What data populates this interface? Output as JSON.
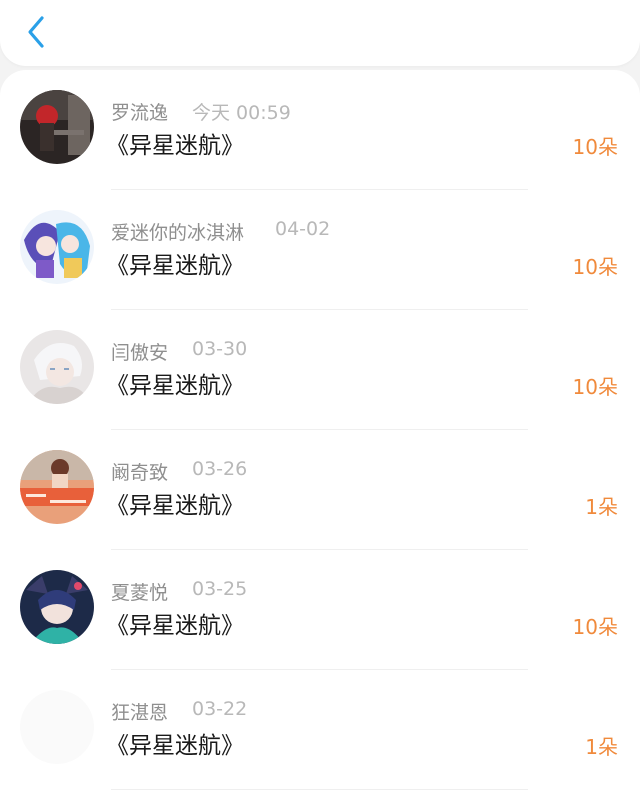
{
  "nav": {
    "back_icon": "chevron-left-icon",
    "accent": "#2aa0e8"
  },
  "list": {
    "count_color": "#f08a3c",
    "items": [
      {
        "name": "罗流逸",
        "date": "今天 00:59",
        "book": "《异星迷航》",
        "count": "10朵"
      },
      {
        "name": "爱迷你的冰淇淋",
        "date": "04-02",
        "book": "《异星迷航》",
        "count": "10朵"
      },
      {
        "name": "闫傲安",
        "date": "03-30",
        "book": "《异星迷航》",
        "count": "10朵"
      },
      {
        "name": "阚奇致",
        "date": "03-26",
        "book": "《异星迷航》",
        "count": "1朵"
      },
      {
        "name": "夏菱悦",
        "date": "03-25",
        "book": "《异星迷航》",
        "count": "10朵"
      },
      {
        "name": "狂湛恩",
        "date": "03-22",
        "book": "《异星迷航》",
        "count": "1朵"
      }
    ]
  }
}
